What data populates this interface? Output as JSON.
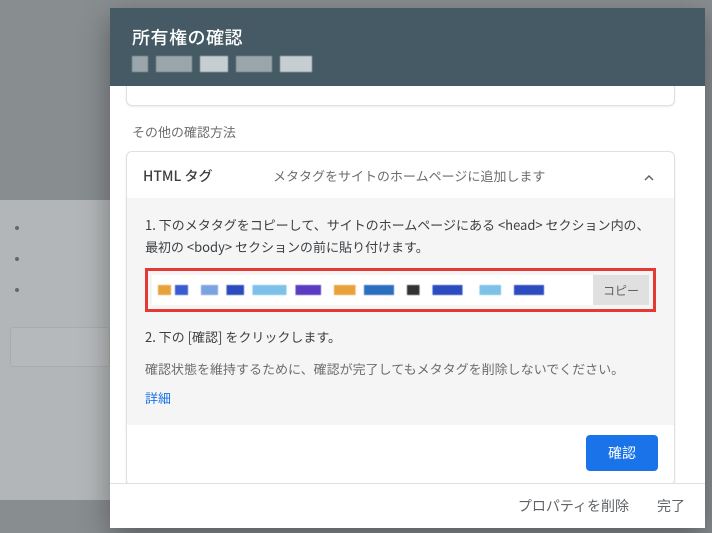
{
  "header": {
    "title": "所有権の確認"
  },
  "section_heading": "その他の確認方法",
  "html_tag_panel": {
    "name": "HTML タグ",
    "desc": "メタタグをサイトのホームページに追加します",
    "step1": "1. 下のメタタグをコピーして、サイトのホームページにある <head> セクション内の、最初の <body> セクションの前に貼り付けます。",
    "copy_label": "コピー",
    "step2": "2. 下の [確認] をクリックします。",
    "note": "確認状態を維持するために、確認が完了してもメタタグを削除しないでください。",
    "details_link": "詳細",
    "verify_label": "確認"
  },
  "footer": {
    "remove_property": "プロパティを削除",
    "done": "完了"
  }
}
